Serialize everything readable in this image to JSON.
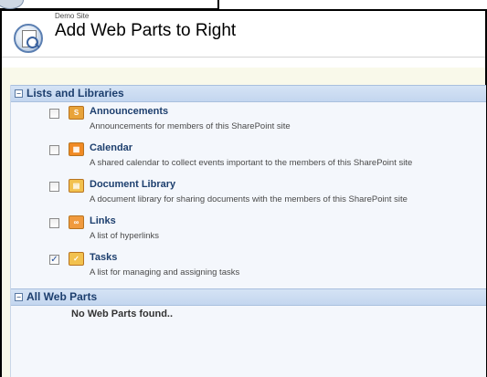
{
  "site": {
    "name": "Demo Site"
  },
  "page": {
    "title": "Add Web Parts to Right"
  },
  "sections": [
    {
      "title": "Lists and Libraries",
      "toggle_symbol": "⊟",
      "items": [
        {
          "name": "Announcements",
          "description": "Announcements for members of this SharePoint site",
          "checked": false,
          "icon": "announcements-icon",
          "icon_glyph": "S",
          "icon_color": "#e8a33a"
        },
        {
          "name": "Calendar",
          "description": "A shared calendar to collect events important to the members of this SharePoint site",
          "checked": false,
          "icon": "calendar-icon",
          "icon_glyph": "▦",
          "icon_color": "#f08a24"
        },
        {
          "name": "Document Library",
          "description": "A document library for sharing documents with the members of this SharePoint site",
          "checked": false,
          "icon": "folder-icon",
          "icon_glyph": "▤",
          "icon_color": "#f2c14e"
        },
        {
          "name": "Links",
          "description": "A list of hyperlinks",
          "checked": false,
          "icon": "links-icon",
          "icon_glyph": "∞",
          "icon_color": "#f09a3e"
        },
        {
          "name": "Tasks",
          "description": "A list for managing and assigning tasks",
          "checked": true,
          "icon": "tasks-icon",
          "icon_glyph": "✓",
          "icon_color": "#f2c14e"
        }
      ]
    },
    {
      "title": "All Web Parts",
      "toggle_symbol": "⊟",
      "empty_message": "No Web Parts found.."
    }
  ],
  "colors": {
    "section_text": "#1d3f6e",
    "panel_bg": "#f4f7fc",
    "outer_bg": "#f9f9ea",
    "header_bar": "#c9dbf1"
  }
}
